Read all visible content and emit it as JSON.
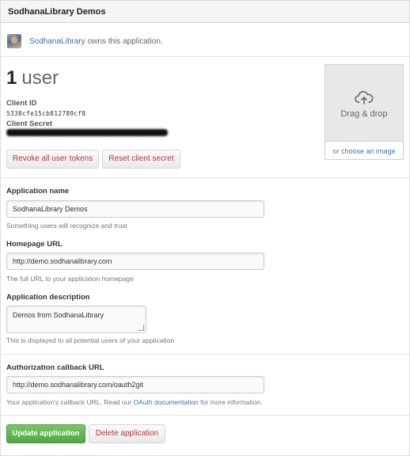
{
  "header": {
    "title": "SodhanaLibrary Demos"
  },
  "owner": {
    "name": "SodhanaLibrary",
    "suffix": "owns this application."
  },
  "users": {
    "count": "1",
    "label": "user"
  },
  "credentials": {
    "client_id_label": "Client ID",
    "client_id": "5338cfe15cb812789cf8",
    "client_secret_label": "Client Secret"
  },
  "actions": {
    "revoke": "Revoke all user tokens",
    "reset_secret": "Reset client secret"
  },
  "logo_upload": {
    "drag_text": "Drag & drop",
    "or_text": "or",
    "choose_link": "choose an image",
    "icon": "cloud-upload-icon"
  },
  "form": {
    "app_name": {
      "label": "Application name",
      "value": "SodhanaLibrary Demos",
      "hint": "Something users will recognize and trust"
    },
    "homepage": {
      "label": "Homepage URL",
      "value": "http://demo.sodhanalibrary.com",
      "hint": "The full URL to your application homepage"
    },
    "description": {
      "label": "Application description",
      "value": "Demos from SodhanaLibrary",
      "hint": "This is displayed to all potential users of your application"
    },
    "callback": {
      "label": "Authorization callback URL",
      "value": "http://demo.sodhanalibrary.com/oauth2git",
      "hint_before": "Your application's callback URL. Read our",
      "hint_link": "OAuth documentation",
      "hint_after": "for more information."
    }
  },
  "buttons": {
    "update": "Update application",
    "delete": "Delete application"
  },
  "colors": {
    "link": "#3b73af",
    "danger": "#b33a3a",
    "primary": "#5aaf4b"
  }
}
